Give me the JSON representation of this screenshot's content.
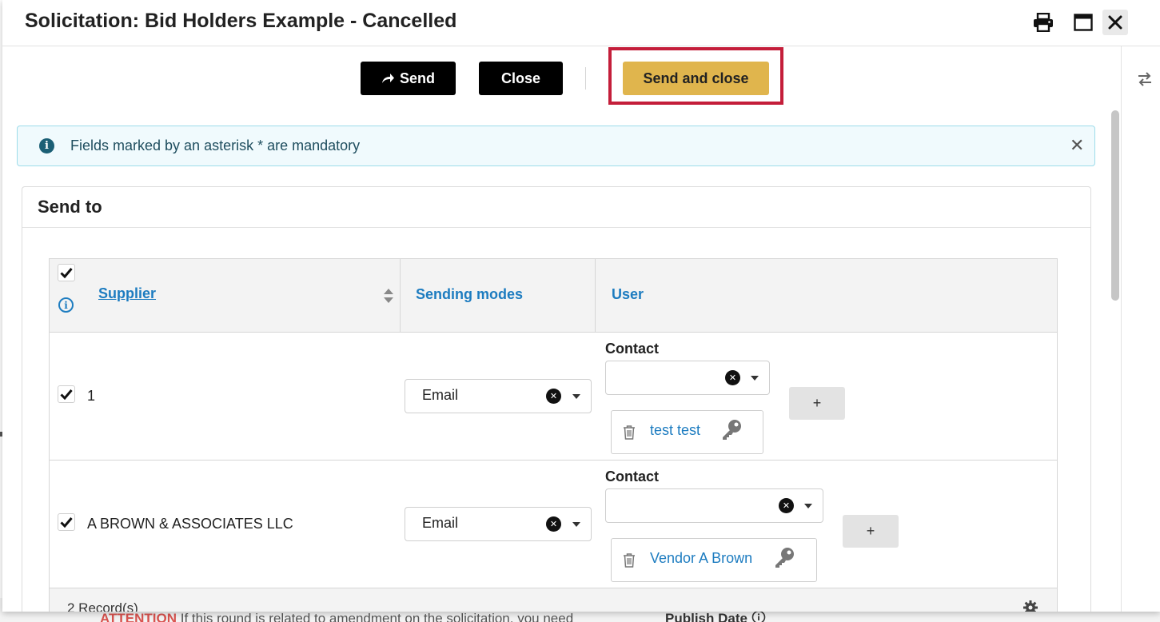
{
  "modal": {
    "title": "Solicitation: Bid Holders Example - Cancelled",
    "header_icons": [
      "printer-icon",
      "maximize-icon",
      "close-icon"
    ]
  },
  "toolbar": {
    "send_label": "Send",
    "send_icon": "share-arrow-icon",
    "close_label": "Close",
    "send_and_close_label": "Send and close",
    "highlight_color": "#c41e3a",
    "gold_color": "#e0b54d"
  },
  "info_banner": {
    "text": "Fields marked by an asterisk * are mandatory",
    "icon": "info-icon"
  },
  "card": {
    "title": "Send to"
  },
  "table": {
    "columns": {
      "supplier": "Supplier",
      "sending_modes": "Sending modes",
      "user": "User"
    },
    "select_all_checked": true,
    "rows": [
      {
        "checked": true,
        "supplier": "1",
        "sending_mode": "Email",
        "contact_label": "Contact",
        "contact_value": "",
        "add_label": "+",
        "user_tag": "test test"
      },
      {
        "checked": true,
        "supplier": "A BROWN & ASSOCIATES LLC",
        "sending_mode": "Email",
        "contact_label": "Contact",
        "contact_value": "",
        "add_label": "+",
        "user_tag": "Vendor A Brown"
      }
    ],
    "footer": {
      "records": "2 Record(s)"
    }
  },
  "background": {
    "attention_label": "ATTENTION",
    "attention_text": "If this round is related to amendment on the solicitation, you need",
    "publish_date": "Publish Date"
  },
  "colors": {
    "link_blue": "#1d7cc0",
    "banner_bg": "#f0fafd",
    "banner_border": "#9ddcea"
  }
}
